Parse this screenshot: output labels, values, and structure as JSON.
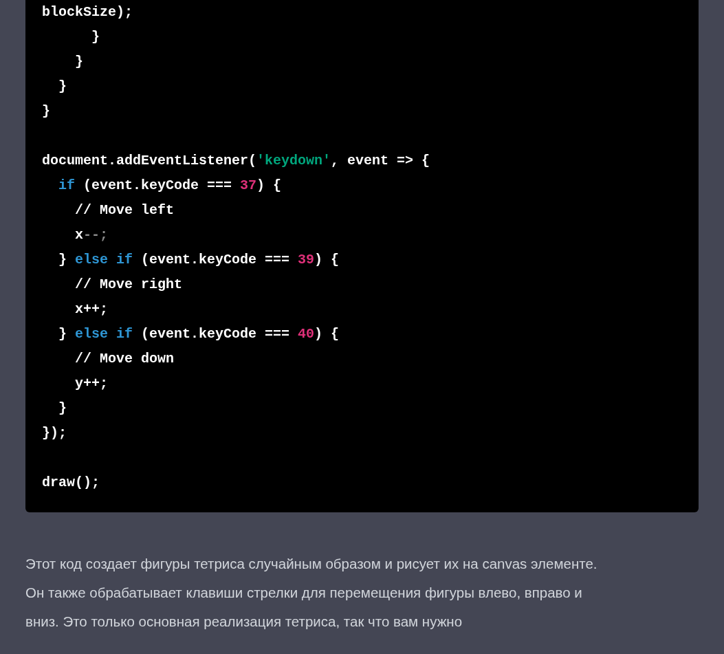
{
  "code_block": {
    "lines": [
      {
        "tokens": [
          {
            "text": "blockSize);",
            "kind": "plain"
          }
        ]
      },
      {
        "tokens": [
          {
            "text": "      }",
            "kind": "plain"
          }
        ]
      },
      {
        "tokens": [
          {
            "text": "    }",
            "kind": "plain"
          }
        ]
      },
      {
        "tokens": [
          {
            "text": "  }",
            "kind": "plain"
          }
        ]
      },
      {
        "tokens": [
          {
            "text": "}",
            "kind": "plain"
          }
        ]
      },
      {
        "gap_before": true,
        "tokens": [
          {
            "text": "document.addEventListener(",
            "kind": "plain"
          },
          {
            "text": "'keydown'",
            "kind": "string"
          },
          {
            "text": ", event => {",
            "kind": "plain"
          }
        ]
      },
      {
        "tokens": [
          {
            "text": "  if",
            "kind": "keyword"
          },
          {
            "text": " (event.keyCode === ",
            "kind": "plain"
          },
          {
            "text": "37",
            "kind": "number"
          },
          {
            "text": ") {",
            "kind": "plain"
          }
        ]
      },
      {
        "tokens": [
          {
            "text": "    // Move left",
            "kind": "plain"
          }
        ]
      },
      {
        "tokens": [
          {
            "text": "    x",
            "kind": "plain"
          },
          {
            "text": "--;",
            "kind": "dim"
          }
        ]
      },
      {
        "tokens": [
          {
            "text": "  } ",
            "kind": "plain"
          },
          {
            "text": "else if",
            "kind": "keyword"
          },
          {
            "text": " (event.keyCode === ",
            "kind": "plain"
          },
          {
            "text": "39",
            "kind": "number"
          },
          {
            "text": ") {",
            "kind": "plain"
          }
        ]
      },
      {
        "tokens": [
          {
            "text": "    // Move right",
            "kind": "plain"
          }
        ]
      },
      {
        "tokens": [
          {
            "text": "    x++;",
            "kind": "plain"
          }
        ]
      },
      {
        "tokens": [
          {
            "text": "  } ",
            "kind": "plain"
          },
          {
            "text": "else if",
            "kind": "keyword"
          },
          {
            "text": " (event.keyCode === ",
            "kind": "plain"
          },
          {
            "text": "40",
            "kind": "number"
          },
          {
            "text": ") {",
            "kind": "plain"
          }
        ]
      },
      {
        "tokens": [
          {
            "text": "    // Move down",
            "kind": "plain"
          }
        ]
      },
      {
        "tokens": [
          {
            "text": "    y++;",
            "kind": "plain"
          }
        ]
      },
      {
        "tokens": [
          {
            "text": "  }",
            "kind": "plain"
          }
        ]
      },
      {
        "tokens": [
          {
            "text": "});",
            "kind": "plain"
          }
        ]
      },
      {
        "gap_before": true,
        "tokens": [
          {
            "text": "draw();",
            "kind": "plain"
          }
        ]
      }
    ]
  },
  "paragraph": "Этот код создает фигуры тетриса случайным образом и рисует их на canvas элементе. Он также обрабатывает клавиши стрелки для перемещения фигуры влево, вправо и вниз. Это только основная реализация тетриса, так что вам нужно"
}
